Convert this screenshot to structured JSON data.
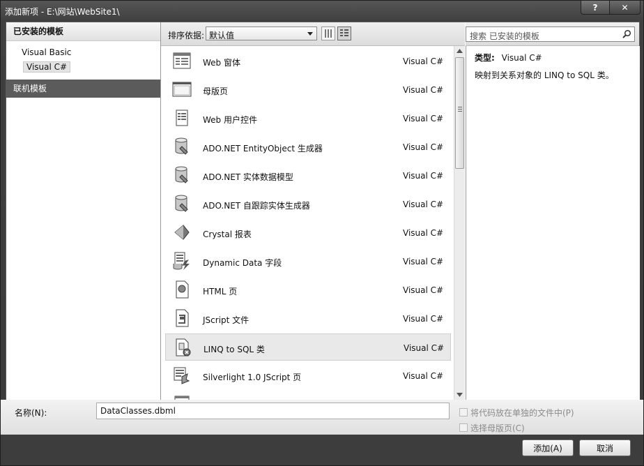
{
  "window": {
    "title": "添加新项 - E:\\网站\\WebSite1\\",
    "help_label": "?",
    "close_label": "✕"
  },
  "left": {
    "header": "已安装的模板",
    "items": [
      {
        "label": "Visual Basic"
      },
      {
        "label": "Visual C#"
      }
    ],
    "selected": "Visual C#",
    "online": "联机模板"
  },
  "toolbar": {
    "sort_label": "排序依据:",
    "sort_value": "默认值"
  },
  "search": {
    "placeholder": "搜索 已安装的模板",
    "icon": "search-icon"
  },
  "templates": [
    {
      "name": "Web 窗体",
      "lang": "Visual C#",
      "icon": "web-form-icon"
    },
    {
      "name": "母版页",
      "lang": "Visual C#",
      "icon": "master-page-icon"
    },
    {
      "name": "Web 用户控件",
      "lang": "Visual C#",
      "icon": "user-control-icon"
    },
    {
      "name": "ADO.NET EntityObject 生成器",
      "lang": "Visual C#",
      "icon": "database-icon"
    },
    {
      "name": "ADO.NET 实体数据模型",
      "lang": "Visual C#",
      "icon": "database-icon"
    },
    {
      "name": "ADO.NET 自跟踪实体生成器",
      "lang": "Visual C#",
      "icon": "database-icon"
    },
    {
      "name": "Crystal 报表",
      "lang": "Visual C#",
      "icon": "crystal-report-icon"
    },
    {
      "name": "Dynamic Data 字段",
      "lang": "Visual C#",
      "icon": "dynamic-data-icon"
    },
    {
      "name": "HTML 页",
      "lang": "Visual C#",
      "icon": "html-page-icon"
    },
    {
      "name": "JScript 文件",
      "lang": "Visual C#",
      "icon": "jscript-file-icon"
    },
    {
      "name": "LINQ to SQL 类",
      "lang": "Visual C#",
      "icon": "linq-to-sql-icon",
      "selected": true
    },
    {
      "name": "Silverlight 1.0 JScript 页",
      "lang": "Visual C#",
      "icon": "silverlight-icon"
    }
  ],
  "detail": {
    "type_label": "类型:",
    "type_value": "Visual C#",
    "description": "映射到关系对象的 LINQ to SQL 类。"
  },
  "bottom": {
    "name_label": "名称(N):",
    "name_value": "DataClasses.dbml",
    "option1": "将代码放在单独的文件中(P)",
    "option2": "选择母版页(C)"
  },
  "buttons": {
    "add": "添加(A)",
    "cancel": "取消"
  }
}
